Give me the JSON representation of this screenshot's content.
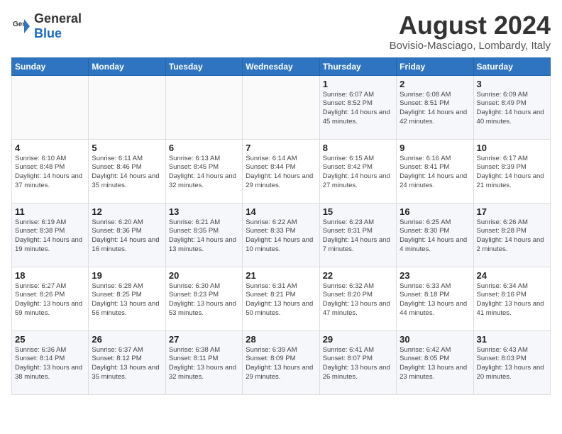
{
  "header": {
    "logo_general": "General",
    "logo_blue": "Blue",
    "month_title": "August 2024",
    "location": "Bovisio-Masciago, Lombardy, Italy"
  },
  "weekdays": [
    "Sunday",
    "Monday",
    "Tuesday",
    "Wednesday",
    "Thursday",
    "Friday",
    "Saturday"
  ],
  "weeks": [
    [
      {
        "day": "",
        "detail": ""
      },
      {
        "day": "",
        "detail": ""
      },
      {
        "day": "",
        "detail": ""
      },
      {
        "day": "",
        "detail": ""
      },
      {
        "day": "1",
        "detail": "Sunrise: 6:07 AM\nSunset: 8:52 PM\nDaylight: 14 hours and 45 minutes."
      },
      {
        "day": "2",
        "detail": "Sunrise: 6:08 AM\nSunset: 8:51 PM\nDaylight: 14 hours and 42 minutes."
      },
      {
        "day": "3",
        "detail": "Sunrise: 6:09 AM\nSunset: 8:49 PM\nDaylight: 14 hours and 40 minutes."
      }
    ],
    [
      {
        "day": "4",
        "detail": "Sunrise: 6:10 AM\nSunset: 8:48 PM\nDaylight: 14 hours and 37 minutes."
      },
      {
        "day": "5",
        "detail": "Sunrise: 6:11 AM\nSunset: 8:46 PM\nDaylight: 14 hours and 35 minutes."
      },
      {
        "day": "6",
        "detail": "Sunrise: 6:13 AM\nSunset: 8:45 PM\nDaylight: 14 hours and 32 minutes."
      },
      {
        "day": "7",
        "detail": "Sunrise: 6:14 AM\nSunset: 8:44 PM\nDaylight: 14 hours and 29 minutes."
      },
      {
        "day": "8",
        "detail": "Sunrise: 6:15 AM\nSunset: 8:42 PM\nDaylight: 14 hours and 27 minutes."
      },
      {
        "day": "9",
        "detail": "Sunrise: 6:16 AM\nSunset: 8:41 PM\nDaylight: 14 hours and 24 minutes."
      },
      {
        "day": "10",
        "detail": "Sunrise: 6:17 AM\nSunset: 8:39 PM\nDaylight: 14 hours and 21 minutes."
      }
    ],
    [
      {
        "day": "11",
        "detail": "Sunrise: 6:19 AM\nSunset: 8:38 PM\nDaylight: 14 hours and 19 minutes."
      },
      {
        "day": "12",
        "detail": "Sunrise: 6:20 AM\nSunset: 8:36 PM\nDaylight: 14 hours and 16 minutes."
      },
      {
        "day": "13",
        "detail": "Sunrise: 6:21 AM\nSunset: 8:35 PM\nDaylight: 14 hours and 13 minutes."
      },
      {
        "day": "14",
        "detail": "Sunrise: 6:22 AM\nSunset: 8:33 PM\nDaylight: 14 hours and 10 minutes."
      },
      {
        "day": "15",
        "detail": "Sunrise: 6:23 AM\nSunset: 8:31 PM\nDaylight: 14 hours and 7 minutes."
      },
      {
        "day": "16",
        "detail": "Sunrise: 6:25 AM\nSunset: 8:30 PM\nDaylight: 14 hours and 4 minutes."
      },
      {
        "day": "17",
        "detail": "Sunrise: 6:26 AM\nSunset: 8:28 PM\nDaylight: 14 hours and 2 minutes."
      }
    ],
    [
      {
        "day": "18",
        "detail": "Sunrise: 6:27 AM\nSunset: 8:26 PM\nDaylight: 13 hours and 59 minutes."
      },
      {
        "day": "19",
        "detail": "Sunrise: 6:28 AM\nSunset: 8:25 PM\nDaylight: 13 hours and 56 minutes."
      },
      {
        "day": "20",
        "detail": "Sunrise: 6:30 AM\nSunset: 8:23 PM\nDaylight: 13 hours and 53 minutes."
      },
      {
        "day": "21",
        "detail": "Sunrise: 6:31 AM\nSunset: 8:21 PM\nDaylight: 13 hours and 50 minutes."
      },
      {
        "day": "22",
        "detail": "Sunrise: 6:32 AM\nSunset: 8:20 PM\nDaylight: 13 hours and 47 minutes."
      },
      {
        "day": "23",
        "detail": "Sunrise: 6:33 AM\nSunset: 8:18 PM\nDaylight: 13 hours and 44 minutes."
      },
      {
        "day": "24",
        "detail": "Sunrise: 6:34 AM\nSunset: 8:16 PM\nDaylight: 13 hours and 41 minutes."
      }
    ],
    [
      {
        "day": "25",
        "detail": "Sunrise: 6:36 AM\nSunset: 8:14 PM\nDaylight: 13 hours and 38 minutes."
      },
      {
        "day": "26",
        "detail": "Sunrise: 6:37 AM\nSunset: 8:12 PM\nDaylight: 13 hours and 35 minutes."
      },
      {
        "day": "27",
        "detail": "Sunrise: 6:38 AM\nSunset: 8:11 PM\nDaylight: 13 hours and 32 minutes."
      },
      {
        "day": "28",
        "detail": "Sunrise: 6:39 AM\nSunset: 8:09 PM\nDaylight: 13 hours and 29 minutes."
      },
      {
        "day": "29",
        "detail": "Sunrise: 6:41 AM\nSunset: 8:07 PM\nDaylight: 13 hours and 26 minutes."
      },
      {
        "day": "30",
        "detail": "Sunrise: 6:42 AM\nSunset: 8:05 PM\nDaylight: 13 hours and 23 minutes."
      },
      {
        "day": "31",
        "detail": "Sunrise: 6:43 AM\nSunset: 8:03 PM\nDaylight: 13 hours and 20 minutes."
      }
    ]
  ]
}
